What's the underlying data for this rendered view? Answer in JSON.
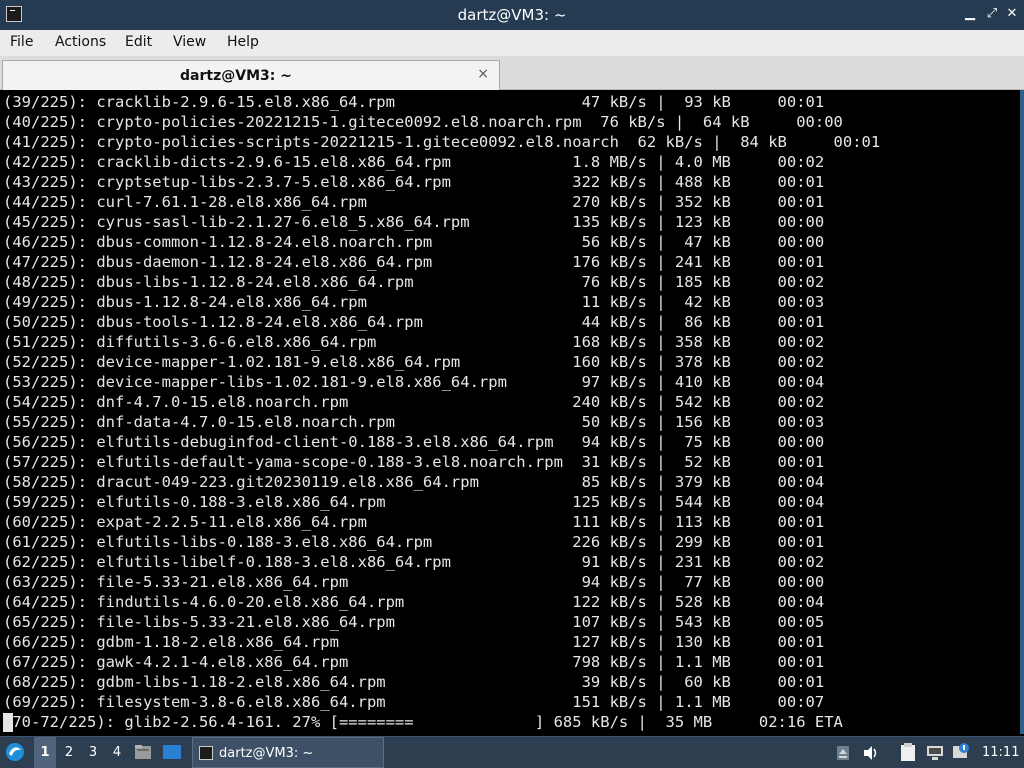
{
  "window": {
    "title": "dartz@VM3: ~",
    "icon": "terminal-icon",
    "controls": [
      "minimize-icon",
      "maximize-icon",
      "close-icon"
    ]
  },
  "menu": [
    "File",
    "Actions",
    "Edit",
    "View",
    "Help"
  ],
  "tab": {
    "label": "dartz@VM3: ~",
    "close": "×"
  },
  "terminal_lines": [
    "(39/225): cracklib-2.9.6-15.el8.x86_64.rpm                    47 kB/s |  93 kB     00:01",
    "(40/225): crypto-policies-20221215-1.gitece0092.el8.noarch.rpm  76 kB/s |  64 kB     00:00",
    "(41/225): crypto-policies-scripts-20221215-1.gitece0092.el8.noarch  62 kB/s |  84 kB     00:01",
    "(42/225): cracklib-dicts-2.9.6-15.el8.x86_64.rpm             1.8 MB/s | 4.0 MB     00:02",
    "(43/225): cryptsetup-libs-2.3.7-5.el8.x86_64.rpm             322 kB/s | 488 kB     00:01",
    "(44/225): curl-7.61.1-28.el8.x86_64.rpm                      270 kB/s | 352 kB     00:01",
    "(45/225): cyrus-sasl-lib-2.1.27-6.el8_5.x86_64.rpm           135 kB/s | 123 kB     00:00",
    "(46/225): dbus-common-1.12.8-24.el8.noarch.rpm                56 kB/s |  47 kB     00:00",
    "(47/225): dbus-daemon-1.12.8-24.el8.x86_64.rpm               176 kB/s | 241 kB     00:01",
    "(48/225): dbus-libs-1.12.8-24.el8.x86_64.rpm                  76 kB/s | 185 kB     00:02",
    "(49/225): dbus-1.12.8-24.el8.x86_64.rpm                       11 kB/s |  42 kB     00:03",
    "(50/225): dbus-tools-1.12.8-24.el8.x86_64.rpm                 44 kB/s |  86 kB     00:01",
    "(51/225): diffutils-3.6-6.el8.x86_64.rpm                     168 kB/s | 358 kB     00:02",
    "(52/225): device-mapper-1.02.181-9.el8.x86_64.rpm            160 kB/s | 378 kB     00:02",
    "(53/225): device-mapper-libs-1.02.181-9.el8.x86_64.rpm        97 kB/s | 410 kB     00:04",
    "(54/225): dnf-4.7.0-15.el8.noarch.rpm                        240 kB/s | 542 kB     00:02",
    "(55/225): dnf-data-4.7.0-15.el8.noarch.rpm                    50 kB/s | 156 kB     00:03",
    "(56/225): elfutils-debuginfod-client-0.188-3.el8.x86_64.rpm   94 kB/s |  75 kB     00:00",
    "(57/225): elfutils-default-yama-scope-0.188-3.el8.noarch.rpm  31 kB/s |  52 kB     00:01",
    "(58/225): dracut-049-223.git20230119.el8.x86_64.rpm           85 kB/s | 379 kB     00:04",
    "(59/225): elfutils-0.188-3.el8.x86_64.rpm                    125 kB/s | 544 kB     00:04",
    "(60/225): expat-2.2.5-11.el8.x86_64.rpm                      111 kB/s | 113 kB     00:01",
    "(61/225): elfutils-libs-0.188-3.el8.x86_64.rpm               226 kB/s | 299 kB     00:01",
    "(62/225): elfutils-libelf-0.188-3.el8.x86_64.rpm              91 kB/s | 231 kB     00:02",
    "(63/225): file-5.33-21.el8.x86_64.rpm                         94 kB/s |  77 kB     00:00",
    "(64/225): findutils-4.6.0-20.el8.x86_64.rpm                  122 kB/s | 528 kB     00:04",
    "(65/225): file-libs-5.33-21.el8.x86_64.rpm                   107 kB/s | 543 kB     00:05",
    "(66/225): gdbm-1.18-2.el8.x86_64.rpm                         127 kB/s | 130 kB     00:01",
    "(67/225): gawk-4.2.1-4.el8.x86_64.rpm                        798 kB/s | 1.1 MB     00:01",
    "(68/225): gdbm-libs-1.18-2.el8.x86_64.rpm                     39 kB/s |  60 kB     00:01",
    "(69/225): filesystem-3.8-6.el8.x86_64.rpm                    151 kB/s | 1.1 MB     00:07",
    "(70-72/225): glib2-2.56.4-161. 27% [========             ] 685 kB/s |  35 MB     02:16 ETA"
  ],
  "taskbar": {
    "start_icon": "lxqt-start-icon",
    "workspaces": [
      "1",
      "2",
      "3",
      "4"
    ],
    "active_workspace": "1",
    "quicklaunch": [
      "file-manager-icon",
      "show-desktop-icon"
    ],
    "task_label": "dartz@VM3: ~",
    "task_icon": "terminal-icon",
    "tray": [
      "eject-icon",
      "volume-icon",
      "clipboard-icon",
      "network-icon",
      "update-icon"
    ],
    "clock": "11:11"
  }
}
